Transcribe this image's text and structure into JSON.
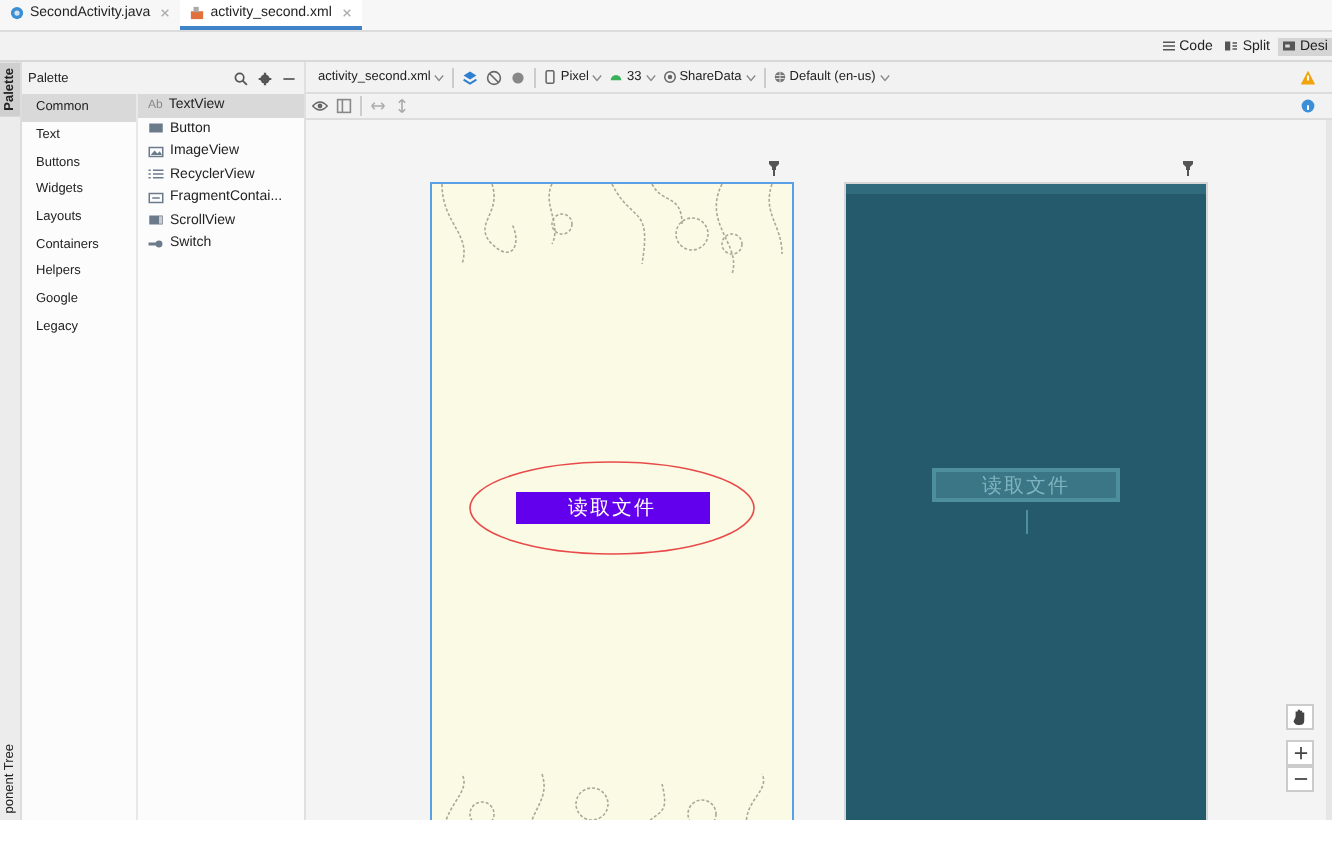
{
  "editor_tabs": [
    {
      "label": "SecondActivity.java",
      "kind": "java",
      "selected": false
    },
    {
      "label": "activity_second.xml",
      "kind": "layout",
      "selected": true
    }
  ],
  "view_modes": [
    {
      "label": "Code",
      "kind": "code",
      "selected": false
    },
    {
      "label": "Split",
      "kind": "split",
      "selected": false
    },
    {
      "label": "Desi",
      "kind": "design",
      "selected": true
    }
  ],
  "side_tabs": [
    {
      "label": "Palette",
      "selected": true
    },
    {
      "label": "ponent Tree",
      "selected": false
    }
  ],
  "palette": {
    "title": "Palette",
    "categories": [
      {
        "label": "Common",
        "selected": true
      },
      {
        "label": "Text",
        "selected": false
      },
      {
        "label": "Buttons",
        "selected": false
      },
      {
        "label": "Widgets",
        "selected": false
      },
      {
        "label": "Layouts",
        "selected": false
      },
      {
        "label": "Containers",
        "selected": false
      },
      {
        "label": "Helpers",
        "selected": false
      },
      {
        "label": "Google",
        "selected": false
      },
      {
        "label": "Legacy",
        "selected": false
      }
    ],
    "items": [
      {
        "label": "TextView",
        "kind": "text",
        "icon_text": "Ab",
        "selected": true
      },
      {
        "label": "Button",
        "kind": "button",
        "selected": false
      },
      {
        "label": "ImageView",
        "kind": "image",
        "selected": false
      },
      {
        "label": "RecyclerView",
        "kind": "list",
        "selected": false
      },
      {
        "label": "FragmentContai...",
        "kind": "fragment",
        "selected": false
      },
      {
        "label": "ScrollView",
        "kind": "scroll",
        "selected": false
      },
      {
        "label": "Switch",
        "kind": "switch",
        "selected": false
      }
    ]
  },
  "toolbar": {
    "file": "activity_second.xml",
    "device": "Pixel",
    "api": "33",
    "theme": "ShareData",
    "locale": "Default (en-us)"
  },
  "design": {
    "button_label": "读取文件"
  },
  "blueprint": {
    "button_label": "读取文件"
  }
}
